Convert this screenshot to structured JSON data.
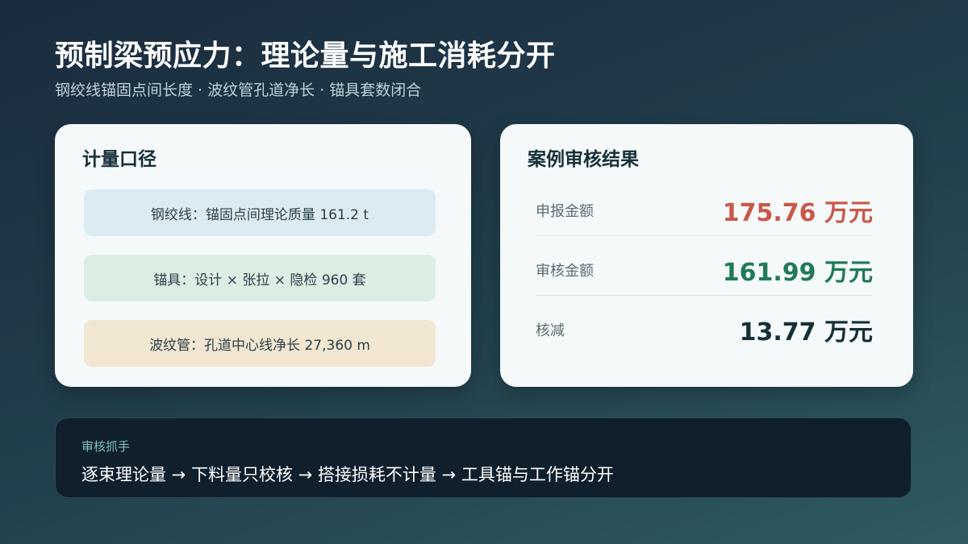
{
  "header": {
    "title": "预制梁预应力：理论量与施工消耗分开",
    "subtitle": "钢绞线锚固点间长度 · 波纹管孔道净长 · 锚具套数闭合"
  },
  "measurement": {
    "title": "计量口径",
    "items": [
      "钢绞线：锚固点间理论质量 161.2 t",
      "锚具：设计 × 张拉 × 隐检 960 套",
      "波纹管：孔道中心线净长 27,360 m"
    ]
  },
  "audit": {
    "title": "案例审核结果",
    "rows": [
      {
        "label": "申报金额",
        "value": "175.76 万元",
        "color": "#c8594a"
      },
      {
        "label": "审核金额",
        "value": "161.99 万元",
        "color": "#1f7a55"
      },
      {
        "label": "核减",
        "value": "13.77 万元",
        "color": "#16303a"
      }
    ]
  },
  "tips": {
    "label": "审核抓手",
    "text": "逐束理论量 → 下料量只校核 → 搭接损耗不计量 → 工具锚与工作锚分开"
  }
}
